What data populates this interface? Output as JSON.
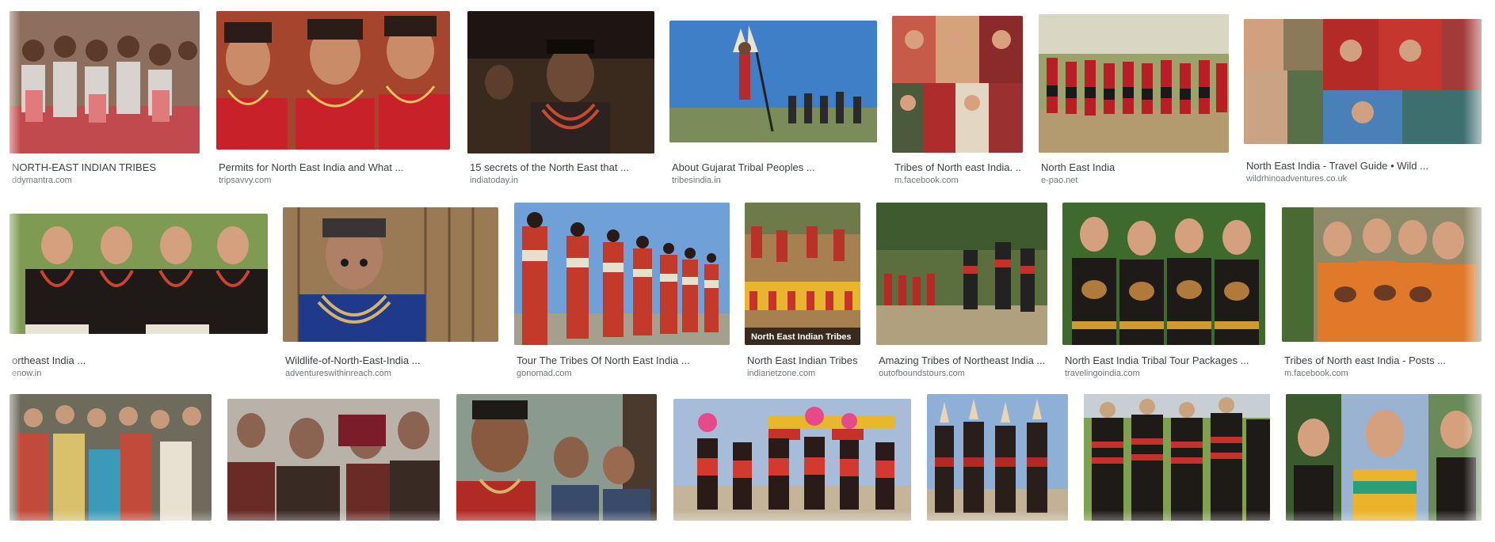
{
  "results": [
    {
      "caption": "NORTH-EAST INDIAN TRIBES",
      "source": "ddymantra.com",
      "img": "tribal-group-photo"
    },
    {
      "caption": "Permits for North East India and What ...",
      "source": "tripsavvy.com",
      "img": "smiling-women-necklaces"
    },
    {
      "caption": "15 secrets of the North East that ...",
      "source": "indiatoday.in",
      "img": "tattooed-elder-portrait"
    },
    {
      "caption": "About Gujarat Tribal Peoples ...",
      "source": "tribesindia.in",
      "img": "feathered-dancer-sky"
    },
    {
      "caption": "Tribes of North east India. ...",
      "source": "m.facebook.com",
      "img": "collage-tribal-women"
    },
    {
      "caption": "North East India",
      "source": "e-pao.net",
      "img": "line-of-dancers"
    },
    {
      "caption": "North East India - Travel Guide • Wild ...",
      "source": "wildrhinoadventures.co.uk",
      "img": "collage-portraits"
    },
    {
      "caption": "ortheast India ...",
      "source": "enow.in",
      "img": "four-women-smiling"
    },
    {
      "caption": "Wildlife-of-North-East-India ...",
      "source": "adventureswithinreach.com",
      "img": "woman-nose-plugs"
    },
    {
      "caption": "Tour The Tribes Of North East India ...",
      "source": "gonomad.com",
      "img": "dancers-row-blue-sky"
    },
    {
      "caption": "North East Indian Tribes",
      "source": "indianetzone.com",
      "img": "festival-crowd"
    },
    {
      "caption": "Amazing Tribes of Northeast India ...",
      "source": "outofboundstours.com",
      "img": "dance-in-field"
    },
    {
      "caption": "North East India Tribal Tour Packages ...",
      "source": "travelingoindia.com",
      "img": "women-with-drums"
    },
    {
      "caption": "Tribes of North east India - Posts ...",
      "source": "m.facebook.com",
      "img": "women-orange-attire"
    },
    {
      "caption": "",
      "source": "",
      "img": "crowd-with-children"
    },
    {
      "caption": "",
      "source": "",
      "img": "elder-women-group"
    },
    {
      "caption": "",
      "source": "",
      "img": "elders-nose-plugs"
    },
    {
      "caption": "",
      "source": "",
      "img": "festival-headdress-dancers"
    },
    {
      "caption": "",
      "source": "",
      "img": "warrior-dancers"
    },
    {
      "caption": "",
      "source": "",
      "img": "striped-shawl-dancers"
    },
    {
      "caption": "",
      "source": "",
      "img": "portrait-collage"
    }
  ],
  "overlay_text": "North East Indian Tribes",
  "colors": {
    "caption": "#3c4043",
    "source": "#70757a",
    "background": "#ffffff"
  }
}
